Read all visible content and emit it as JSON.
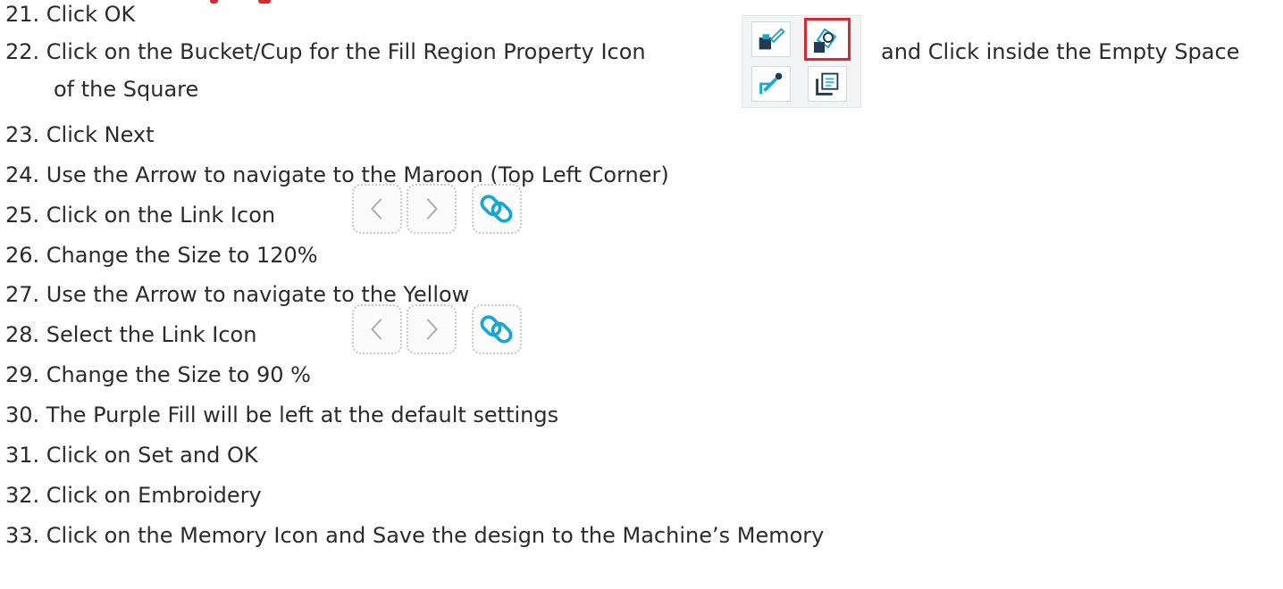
{
  "steps": [
    "21. Click OK",
    "22. Click on the Bucket/Cup for the Fill Region Property Icon",
    "of the Square",
    "23. Click Next",
    "24. Use the Arrow to navigate to the Maroon (Top Left Corner)",
    "25. Click on the Link Icon",
    "26. Change the Size to 120%",
    "27. Use the Arrow to navigate to the Yellow",
    "28. Select the Link Icon",
    "29. Change the Size to 90 %",
    "30. The Purple Fill will be left at the default settings",
    "31. Click on Set and OK",
    "32. Click on Embroidery",
    "33. Click on the Memory Icon and Save the design to the Machine’s Memory"
  ],
  "step22_suffix": "and  Click inside the Empty Space",
  "icons": {
    "tool_panel": [
      "paint-brush-icon",
      "fill-bucket-icon",
      "eyedropper-icon",
      "fill-region-property-icon"
    ],
    "nav_buttons": [
      "arrow-left-icon",
      "arrow-right-icon",
      "link-icon"
    ]
  },
  "colors": {
    "highlight": "#d9282f",
    "icon_teal": "#1aa7c9",
    "icon_dark": "#243a52",
    "link_icon": "#19a7cf"
  }
}
